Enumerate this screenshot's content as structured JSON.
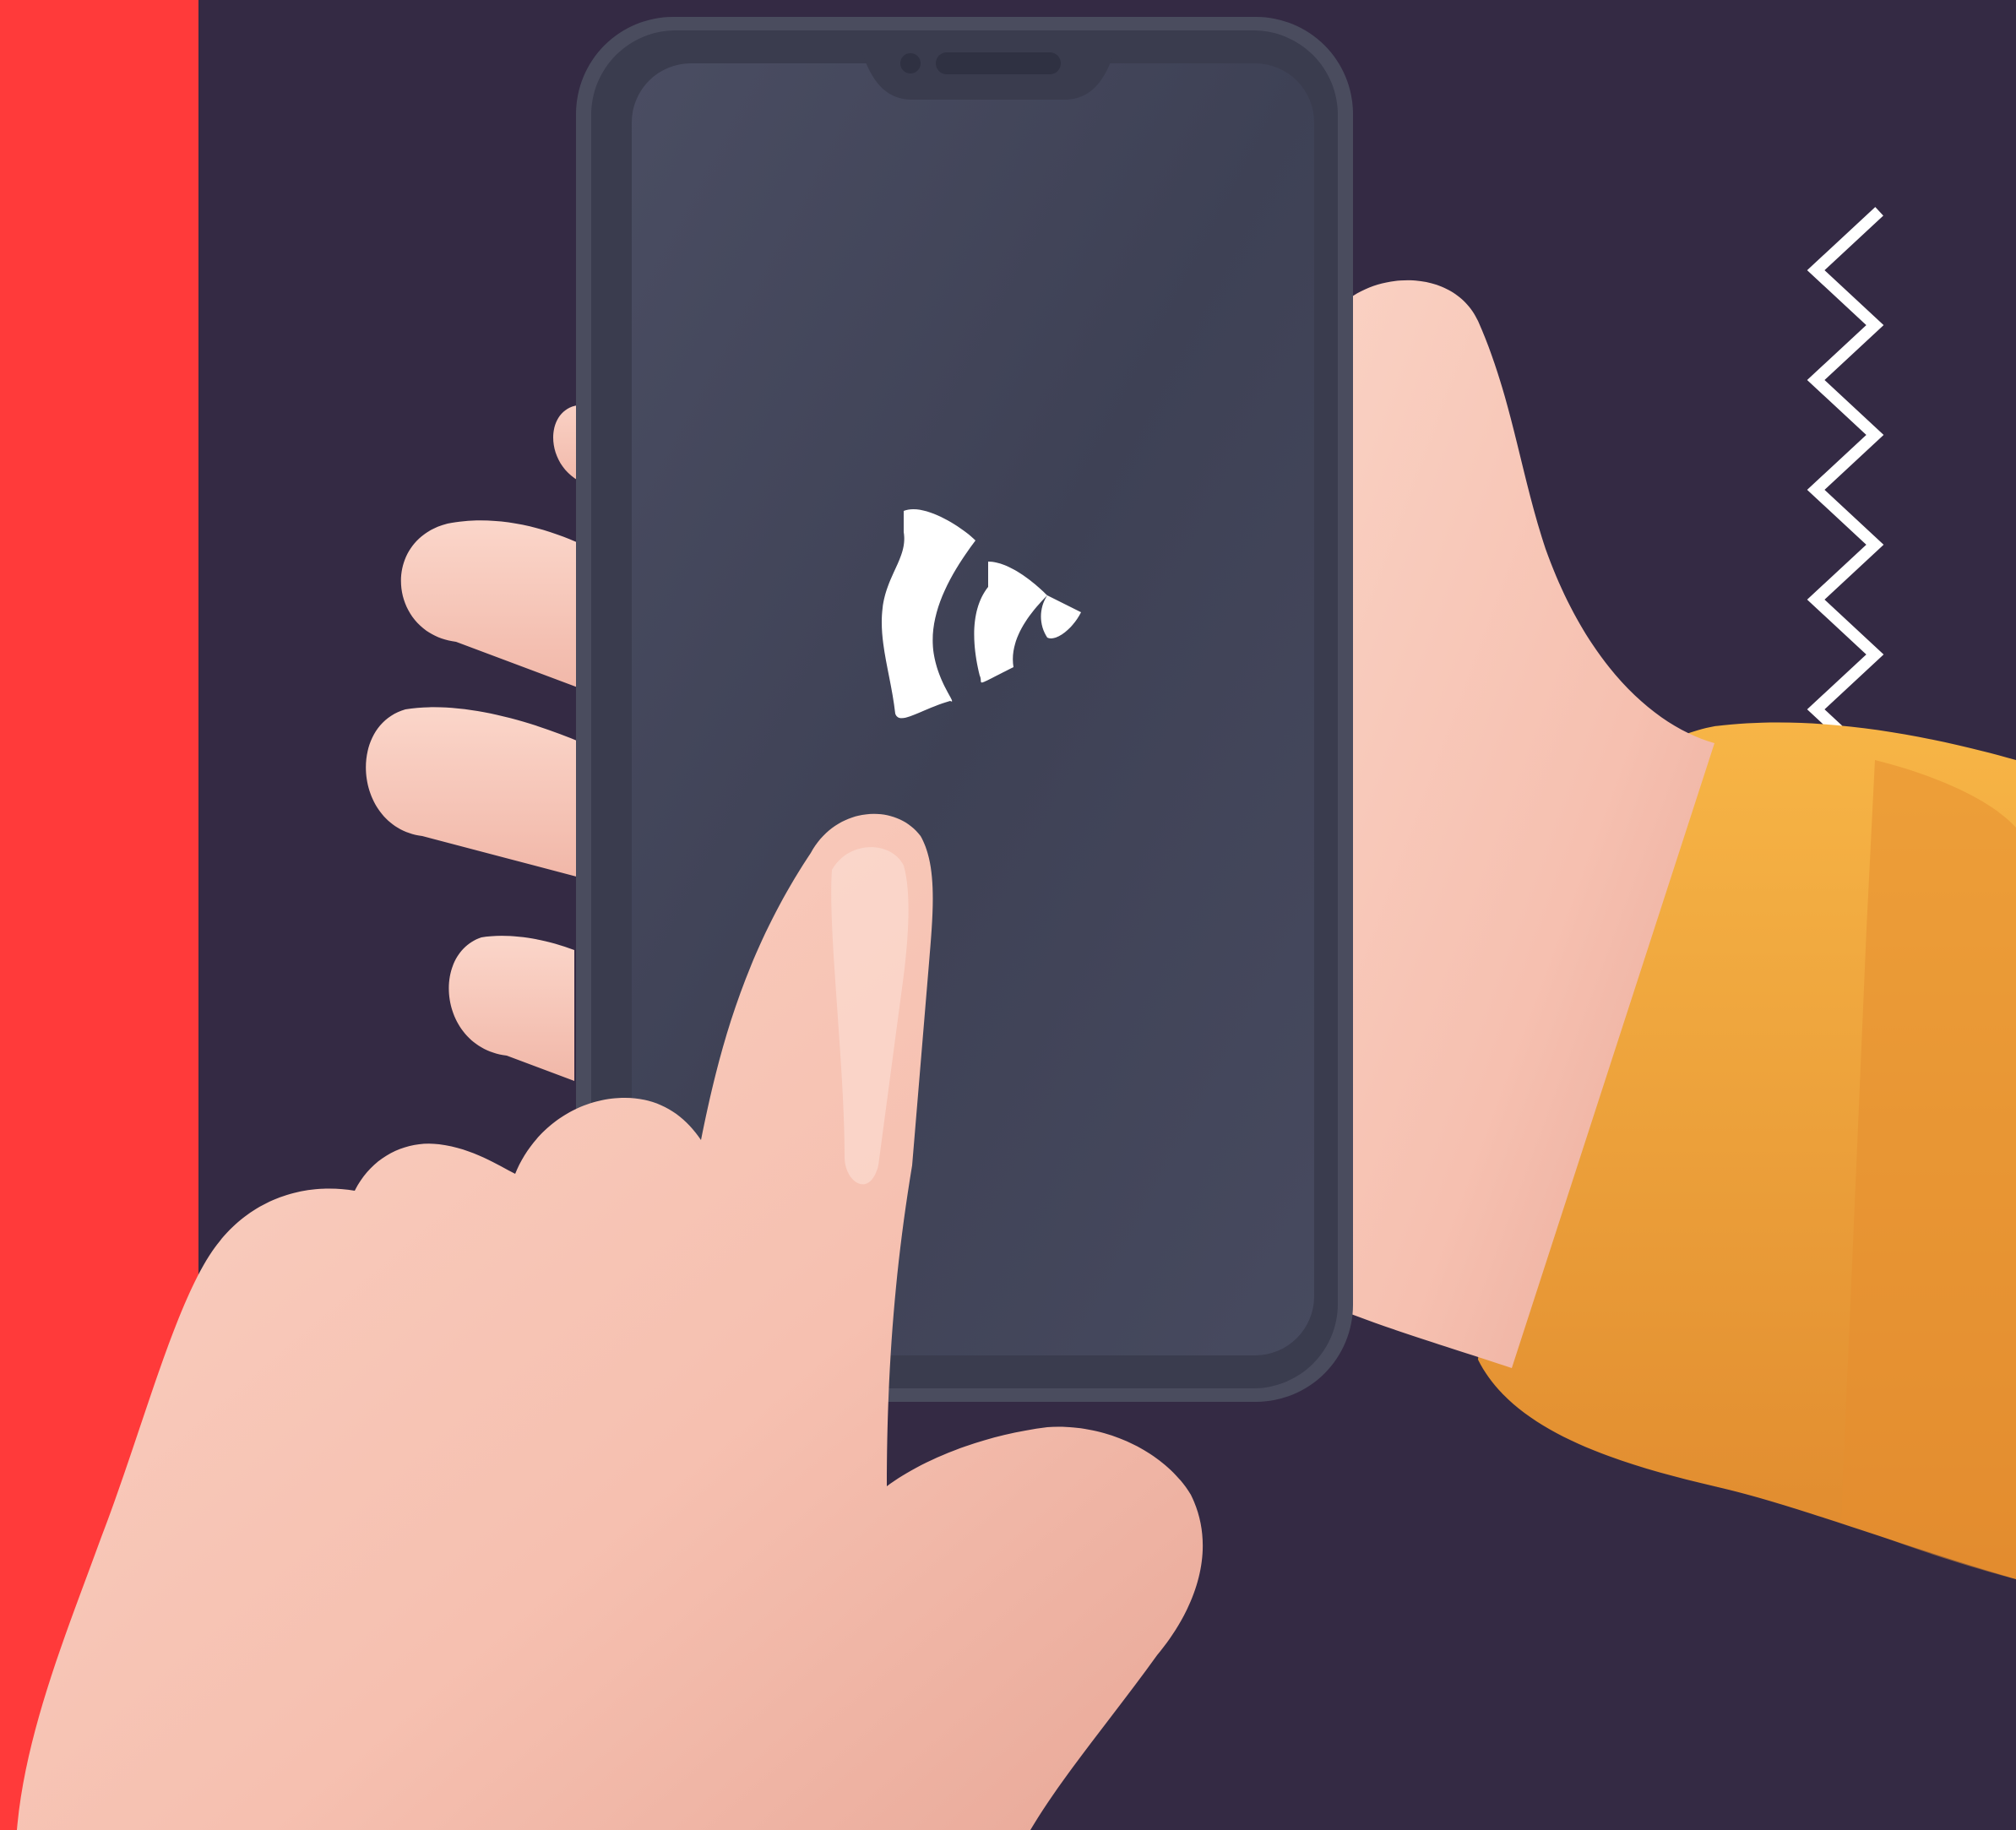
{
  "scene": {
    "description_icons": [
      "phone-icon",
      "app-logo-icon",
      "zigzag-icon"
    ],
    "colors": {
      "background": "#342A44",
      "accent_red": "#FF3A3A",
      "phone_body": "#4A4C5E",
      "phone_screen": "#3F4256",
      "skin": "#F7C2B4",
      "sleeve": "#F2A63A",
      "side_buttons": "#E45AA8",
      "logo": "#FFFFFF",
      "zigzag": "#FFFFFF"
    }
  }
}
